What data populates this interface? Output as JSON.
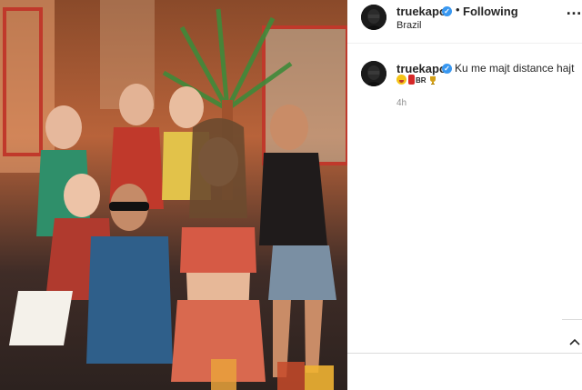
{
  "post": {
    "username": "truekapo",
    "verified_mark": "✓",
    "separator": "•",
    "follow_label": "Following",
    "location": "Brazil",
    "more_label": "…",
    "photo_description_icon": "group-photo"
  },
  "comment": {
    "username": "truekapo",
    "text": "Ku me majt distance hajt",
    "emoji_text": "BR",
    "time": "4h"
  },
  "colors": {
    "verified": "#3897f0",
    "secondary_text": "#8e8e8e",
    "divider": "#dbdbdb"
  }
}
